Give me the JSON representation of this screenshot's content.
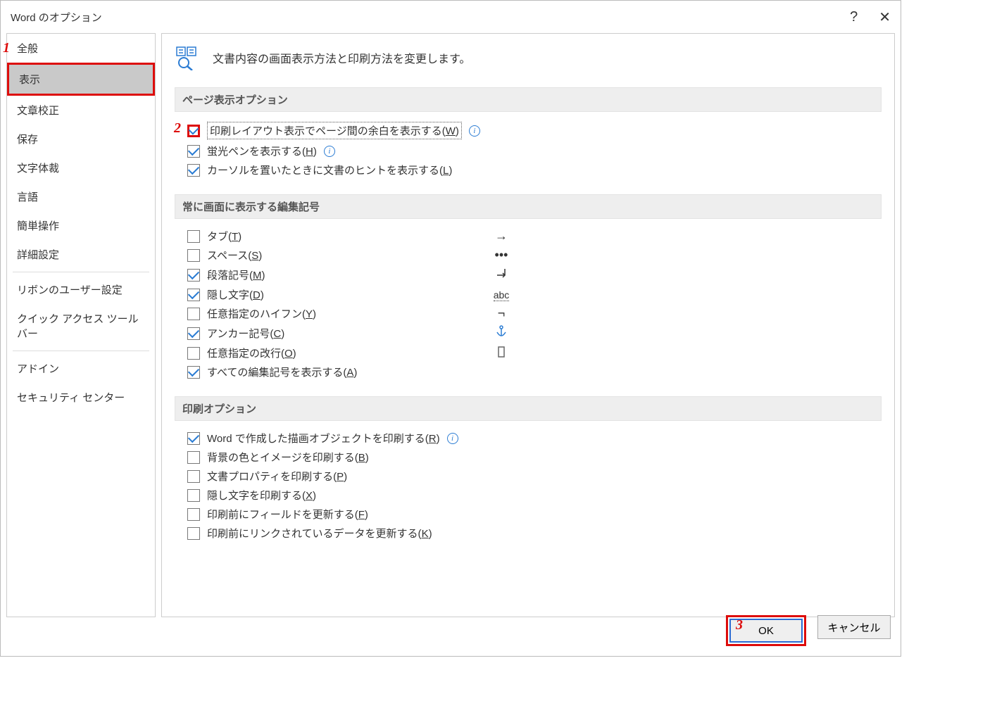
{
  "window": {
    "title": "Word のオプション",
    "help": "?",
    "close": "✕"
  },
  "annotations": {
    "n1": "1",
    "n2": "2",
    "n3": "3"
  },
  "sidebar": {
    "items": [
      {
        "label": "全般"
      },
      {
        "label": "表示"
      },
      {
        "label": "文章校正"
      },
      {
        "label": "保存"
      },
      {
        "label": "文字体裁"
      },
      {
        "label": "言語"
      },
      {
        "label": "簡単操作"
      },
      {
        "label": "詳細設定"
      },
      {
        "label": "リボンのユーザー設定"
      },
      {
        "label": "クイック アクセス ツール バー"
      },
      {
        "label": "アドイン"
      },
      {
        "label": "セキュリティ センター"
      }
    ],
    "selected_index": 1
  },
  "header": {
    "text": "文書内容の画面表示方法と印刷方法を変更します。"
  },
  "sections": {
    "page_display": {
      "title": "ページ表示オプション",
      "options": [
        {
          "label": "印刷レイアウト表示でページ間の余白を表示する(",
          "key": "W",
          "suffix": ")",
          "checked": true,
          "info": true,
          "highlighted": true
        },
        {
          "label": "蛍光ペンを表示する(",
          "key": "H",
          "suffix": ")",
          "checked": true,
          "info": true
        },
        {
          "label": "カーソルを置いたときに文書のヒントを表示する(",
          "key": "L",
          "suffix": ")",
          "checked": true
        }
      ]
    },
    "formatting_marks": {
      "title": "常に画面に表示する編集記号",
      "options": [
        {
          "label": "タブ(",
          "key": "T",
          "suffix": ")",
          "checked": false,
          "glyph": "→"
        },
        {
          "label": "スペース(",
          "key": "S",
          "suffix": ")",
          "checked": false,
          "glyph": "•••"
        },
        {
          "label": "段落記号(",
          "key": "M",
          "suffix": ")",
          "checked": true,
          "glyph": "↵"
        },
        {
          "label": "隠し文字(",
          "key": "D",
          "suffix": ")",
          "checked": true,
          "glyph": "abc"
        },
        {
          "label": "任意指定のハイフン(",
          "key": "Y",
          "suffix": ")",
          "checked": false,
          "glyph": "¬"
        },
        {
          "label": "アンカー記号(",
          "key": "C",
          "suffix": ")",
          "checked": true,
          "glyph": "anchor"
        },
        {
          "label": "任意指定の改行(",
          "key": "O",
          "suffix": ")",
          "checked": false,
          "glyph": "▯"
        },
        {
          "label": "すべての編集記号を表示する(",
          "key": "A",
          "suffix": ")",
          "checked": true
        }
      ]
    },
    "print": {
      "title": "印刷オプション",
      "options": [
        {
          "label": "Word で作成した描画オブジェクトを印刷する(",
          "key": "R",
          "suffix": ")",
          "checked": true,
          "info": true
        },
        {
          "label": "背景の色とイメージを印刷する(",
          "key": "B",
          "suffix": ")",
          "checked": false
        },
        {
          "label": "文書プロパティを印刷する(",
          "key": "P",
          "suffix": ")",
          "checked": false
        },
        {
          "label": "隠し文字を印刷する(",
          "key": "X",
          "suffix": ")",
          "checked": false
        },
        {
          "label": "印刷前にフィールドを更新する(",
          "key": "F",
          "suffix": ")",
          "checked": false
        },
        {
          "label": "印刷前にリンクされているデータを更新する(",
          "key": "K",
          "suffix": ")",
          "checked": false
        }
      ]
    }
  },
  "footer": {
    "ok": "OK",
    "cancel": "キャンセル"
  }
}
